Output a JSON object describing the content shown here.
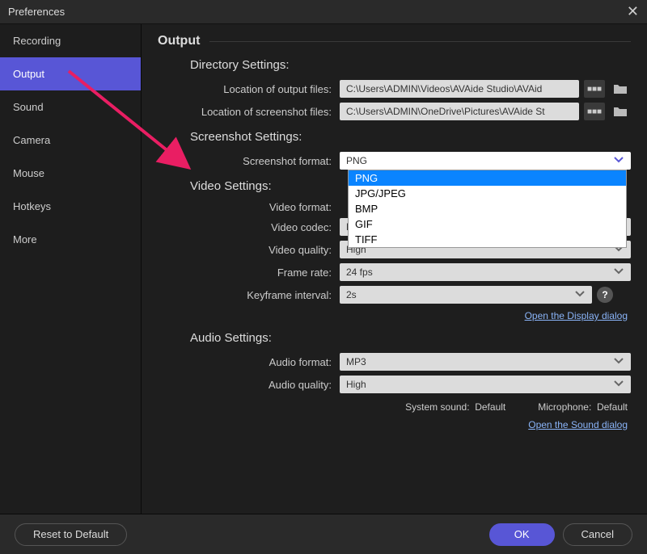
{
  "window": {
    "title": "Preferences"
  },
  "sidebar": {
    "items": [
      {
        "label": "Recording"
      },
      {
        "label": "Output"
      },
      {
        "label": "Sound"
      },
      {
        "label": "Camera"
      },
      {
        "label": "Mouse"
      },
      {
        "label": "Hotkeys"
      },
      {
        "label": "More"
      }
    ],
    "active_index": 1
  },
  "main": {
    "title": "Output",
    "directory": {
      "heading": "Directory Settings:",
      "output_label": "Location of output files:",
      "output_value": "C:\\Users\\ADMIN\\Videos\\AVAide Studio\\AVAid",
      "screenshot_label": "Location of screenshot files:",
      "screenshot_value": "C:\\Users\\ADMIN\\OneDrive\\Pictures\\AVAide St"
    },
    "screenshot": {
      "heading": "Screenshot Settings:",
      "format_label": "Screenshot format:",
      "format_value": "PNG",
      "format_options": [
        "PNG",
        "JPG/JPEG",
        "BMP",
        "GIF",
        "TIFF"
      ]
    },
    "video": {
      "heading": "Video Settings:",
      "format_label": "Video format:",
      "codec_label": "Video codec:",
      "codec_value": "H.264",
      "quality_label": "Video quality:",
      "quality_value": "High",
      "framerate_label": "Frame rate:",
      "framerate_value": "24 fps",
      "keyframe_label": "Keyframe interval:",
      "keyframe_value": "2s",
      "display_link": "Open the Display dialog"
    },
    "audio": {
      "heading": "Audio Settings:",
      "format_label": "Audio format:",
      "format_value": "MP3",
      "quality_label": "Audio quality:",
      "quality_value": "High",
      "system_label": "System sound:",
      "system_value": "Default",
      "mic_label": "Microphone:",
      "mic_value": "Default",
      "sound_link": "Open the Sound dialog"
    }
  },
  "footer": {
    "reset": "Reset to Default",
    "ok": "OK",
    "cancel": "Cancel"
  }
}
